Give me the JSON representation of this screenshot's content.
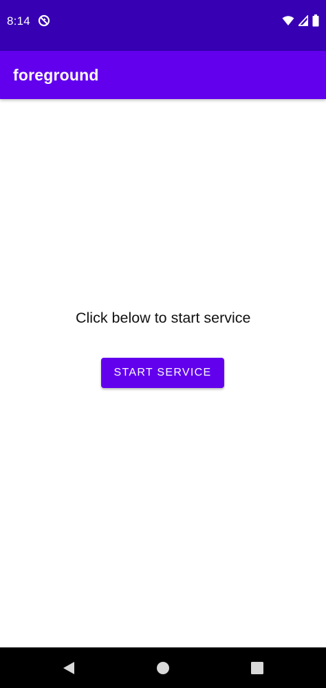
{
  "status_bar": {
    "time": "8:14",
    "left_icon": "sync-disabled-icon",
    "right_icons": [
      "wifi-icon",
      "cellular-signal-icon",
      "battery-icon"
    ],
    "background_color": "#3700b3"
  },
  "app_bar": {
    "title": "foreground",
    "background_color": "#6200ee"
  },
  "main": {
    "message": "Click below to start service",
    "start_button_label": "START SERVICE",
    "button_color": "#6200ee"
  },
  "nav_bar": {
    "icons": [
      "back-icon",
      "home-icon",
      "recents-icon"
    ]
  }
}
